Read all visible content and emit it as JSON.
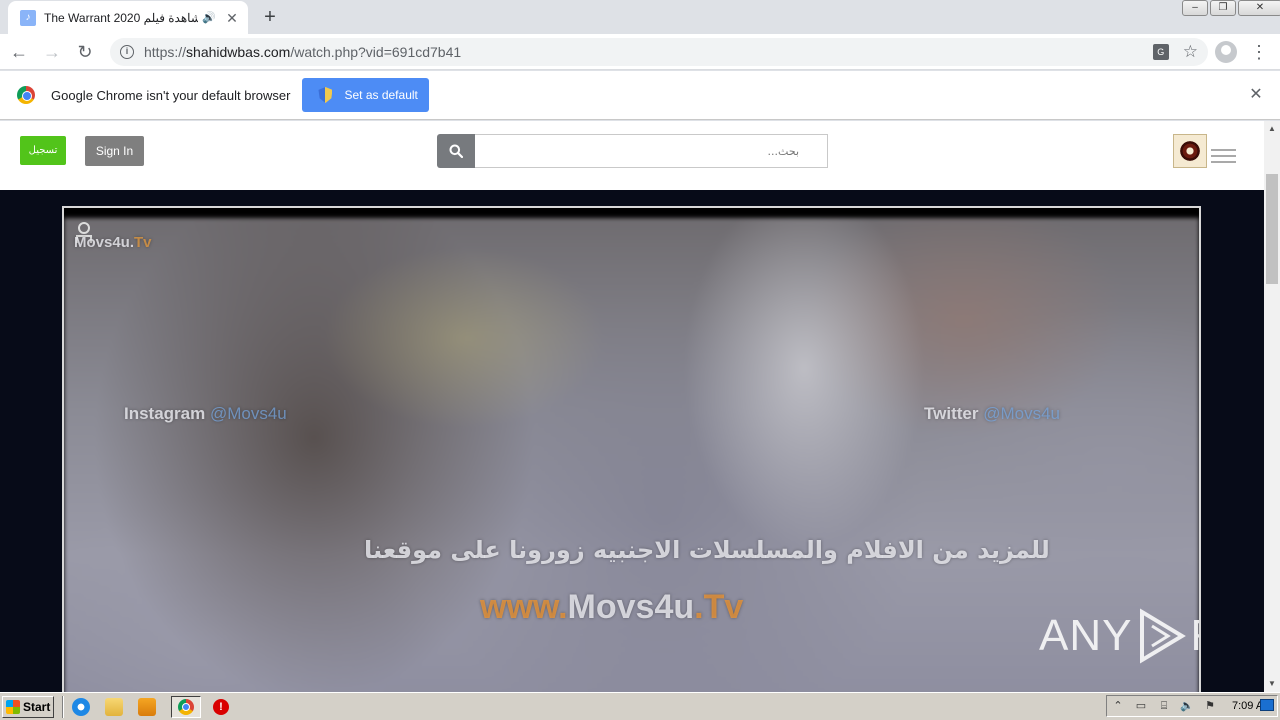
{
  "browser": {
    "tab": {
      "title": "The Warrant 2020 مشاهدة فيلم",
      "favicon": "music-note-icon",
      "audio_icon": "speaker-icon"
    },
    "new_tab": "+",
    "url": {
      "scheme": "https://",
      "host": "shahidwbas.com",
      "path": "/watch.php?vid=691cd7b41"
    },
    "infobar": {
      "message": "Google Chrome isn't your default browser",
      "button": "Set as default"
    }
  },
  "site": {
    "register_label": "تسجيل",
    "signin_label": "Sign In",
    "search_placeholder": "بحث..."
  },
  "video": {
    "watermarks": {
      "corner_brand": "Movs4u.",
      "corner_tld": "Tv",
      "instagram_label": "Instagram",
      "instagram_handle": "@Movs4u",
      "twitter_label": "Twitter",
      "twitter_handle": "@Movs4u",
      "arabic_banner": "للمزيد من الافلام والمسلسلات الاجنبيه زورونا على موقعنا",
      "site_www": "www.",
      "site_name": "Movs4u",
      "site_tld": ".Tv"
    },
    "overlay": {
      "left": "ANY",
      "right": "RUN"
    }
  },
  "taskbar": {
    "start_label": "Start",
    "clock": "7:09 AM"
  },
  "colors": {
    "register_button": "#52c41a",
    "signin_button": "#7f7f7f",
    "set_default_button": "#4d8cf5",
    "page_background": "#070b18"
  }
}
